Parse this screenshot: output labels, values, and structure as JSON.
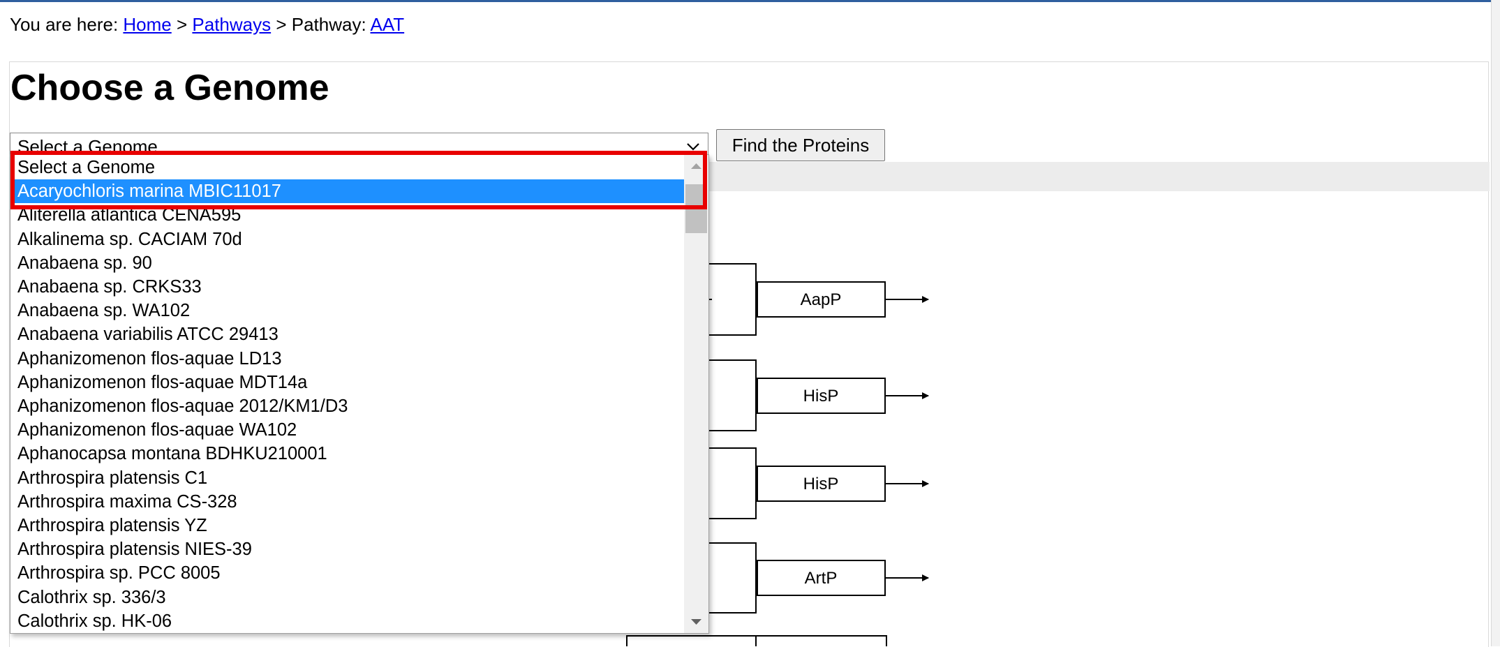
{
  "breadcrumb": {
    "prefix": "You are here: ",
    "home": "Home",
    "sep1": " > ",
    "pathways": "Pathways",
    "sep2": " > Pathway: ",
    "current": "AAT"
  },
  "page": {
    "title": "Choose a Genome"
  },
  "form": {
    "select_value": "Select a Genome",
    "find_button": "Find the Proteins"
  },
  "dropdown": {
    "selected_index": 1,
    "options": [
      "Select a Genome",
      "Acaryochloris marina MBIC11017",
      "Aliterella atlantica CENA595",
      "Alkalinema sp. CACIAM 70d",
      "Anabaena sp. 90",
      "Anabaena sp. CRKS33",
      "Anabaena sp. WA102",
      "Anabaena variabilis ATCC 29413",
      "Aphanizomenon flos-aquae LD13",
      "Aphanizomenon flos-aquae MDT14a",
      "Aphanizomenon flos-aquae 2012/KM1/D3",
      "Aphanizomenon flos-aquae WA102",
      "Aphanocapsa montana BDHKU210001",
      "Arthrospira platensis C1",
      "Arthrospira maxima CS-328",
      "Arthrospira platensis YZ",
      "Arthrospira platensis NIES-39",
      "Arthrospira sp. PCC 8005",
      "Calothrix sp. 336/3",
      "Calothrix sp. HK-06"
    ]
  },
  "diagram": {
    "nodes": [
      "AapP",
      "HisP",
      "HisP",
      "ArtP"
    ]
  },
  "colors": {
    "link": "#0000ee",
    "selected_option": "#1e90ff",
    "highlight_box": "#e80000",
    "top_rule": "#2f5f9e"
  }
}
